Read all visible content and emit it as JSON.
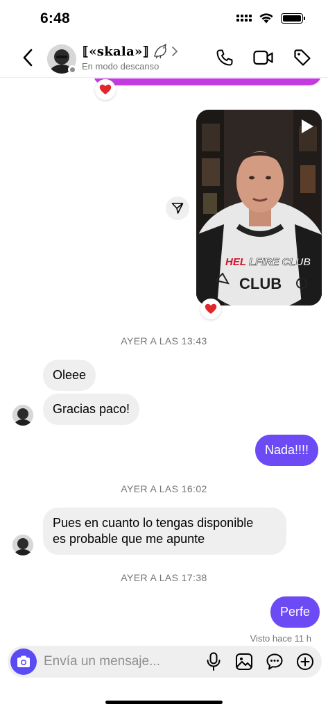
{
  "status_bar": {
    "time": "6:48"
  },
  "header": {
    "contact_name": "⟦«skala»⟧",
    "contact_status": "En modo descanso"
  },
  "messages": {
    "video_shirt_text": "HELLFIRE CLUB",
    "video_shirt_text_red": "HEL",
    "video_shirt_text_white": "LFIRE CLUB",
    "video_shirt_club": "CLUB",
    "timestamp_1": "AYER A LAS 13:43",
    "bubble_1": "Oleee",
    "bubble_2": "Gracias paco!",
    "bubble_3": "Nada!!!!",
    "timestamp_2": "AYER A LAS 16:02",
    "bubble_4_line1": "Pues en cuanto lo tengas disponible",
    "bubble_4_line2": "es probable que me apunte",
    "timestamp_3": "AYER A LAS 17:38",
    "bubble_5": "Perfe",
    "seen_text": "Visto hace 11 h"
  },
  "composer": {
    "placeholder": "Envía un mensaje..."
  },
  "colors": {
    "outgoing_bubble": "#6c4bf5",
    "incoming_bubble": "#efeff0",
    "previous_bubble": "#c33be0",
    "camera_button": "#5a4cf5"
  },
  "icons": [
    "signal-icon",
    "wifi-icon",
    "battery-icon",
    "back-chevron-icon",
    "phone-icon",
    "video-call-icon",
    "tag-icon",
    "heart-reaction-icon",
    "play-icon",
    "share-icon",
    "camera-icon",
    "microphone-icon",
    "gallery-icon",
    "sticker-icon",
    "plus-icon"
  ]
}
